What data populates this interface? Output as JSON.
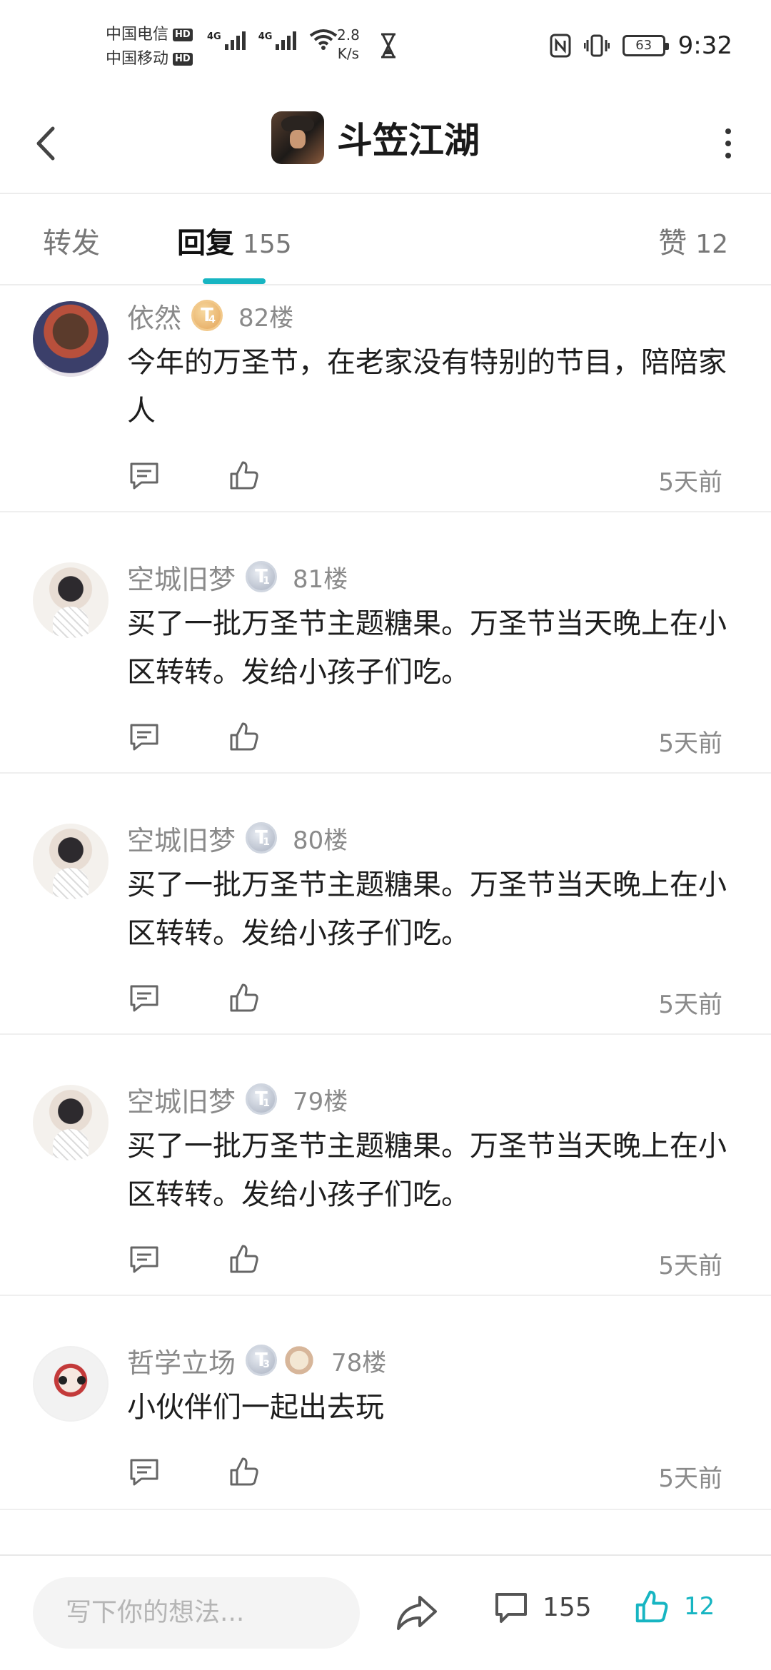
{
  "status_bar": {
    "carrier1": "中国电信",
    "carrier2": "中国移动",
    "hd": "HD",
    "net1": "4G",
    "net2": "4G",
    "speed_value": "2.8",
    "speed_unit": "K/s",
    "battery": "63",
    "time": "9:32"
  },
  "header": {
    "title": "斗笠江湖"
  },
  "tabs": {
    "repost_label": "转发",
    "reply_label": "回复",
    "reply_count": "155",
    "like_label": "赞",
    "like_count": "12"
  },
  "comments": [
    {
      "username": "依然",
      "badge_letter": "T",
      "badge_level": "4",
      "floor": "82楼",
      "content": "今年的万圣节，在老家没有特别的节目，陪陪家人",
      "time": "5天前"
    },
    {
      "username": "空城旧梦",
      "badge_letter": "T",
      "badge_level": "1",
      "floor": "81楼",
      "content": "买了一批万圣节主题糖果。万圣节当天晚上在小区转转。发给小孩子们吃。",
      "time": "5天前"
    },
    {
      "username": "空城旧梦",
      "badge_letter": "T",
      "badge_level": "1",
      "floor": "80楼",
      "content": "买了一批万圣节主题糖果。万圣节当天晚上在小区转转。发给小孩子们吃。",
      "time": "5天前"
    },
    {
      "username": "空城旧梦",
      "badge_letter": "T",
      "badge_level": "1",
      "floor": "79楼",
      "content": "买了一批万圣节主题糖果。万圣节当天晚上在小区转转。发给小孩子们吃。",
      "time": "5天前"
    },
    {
      "username": "哲学立场",
      "badge_letter": "T",
      "badge_level": "3",
      "floor": "78楼",
      "content": "小伙伴们一起出去玩",
      "time": "5天前"
    }
  ],
  "bottom_bar": {
    "input_placeholder": "写下你的想法...",
    "comment_count": "155",
    "like_count": "12"
  },
  "colors": {
    "accent": "#17b5c2",
    "muted_text": "#8a8a8a",
    "badge_gold": "#e4a55a",
    "badge_silver": "#a8b0c0"
  },
  "icons": {
    "back": "chevron-left-icon",
    "more": "more-vertical-icon",
    "reply": "comment-icon",
    "like": "thumbs-up-icon",
    "share": "share-arrow-icon"
  }
}
